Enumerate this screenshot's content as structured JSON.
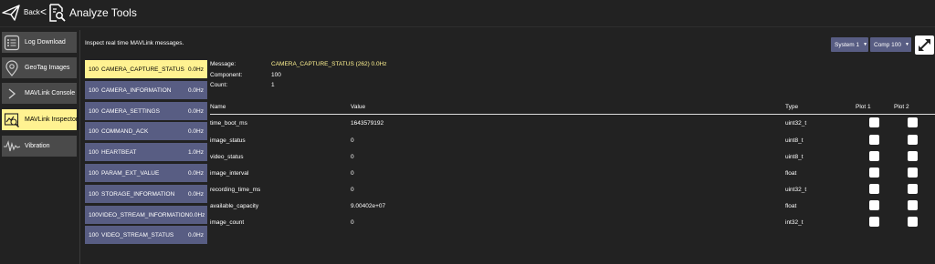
{
  "header": {
    "back_label": "Back",
    "back_chevron": "<",
    "title": "Analyze Tools",
    "back_icon": "paper-plane-icon",
    "title_icon": "analyze-document-icon"
  },
  "sidebar": {
    "items": [
      {
        "label": "Log Download",
        "icon": "log-list-icon",
        "active": false
      },
      {
        "label": "GeoTag Images",
        "icon": "map-pin-icon",
        "active": false
      },
      {
        "label": "MAVLink Console",
        "icon": "console-chevron-icon",
        "active": false
      },
      {
        "label": "MAVLink Inspector",
        "icon": "inspector-chart-icon",
        "active": true
      },
      {
        "label": "Vibration",
        "icon": "waveform-icon",
        "active": false
      }
    ]
  },
  "main": {
    "description": "Inspect real time MAVLink messages.",
    "system_dropdown": "System 1",
    "component_dropdown": "Comp 100",
    "messages": [
      {
        "id": "100",
        "name": "CAMERA_CAPTURE_STATUS",
        "rate": "0.0Hz",
        "active": true
      },
      {
        "id": "100",
        "name": "CAMERA_INFORMATION",
        "rate": "0.0Hz",
        "active": false
      },
      {
        "id": "100",
        "name": "CAMERA_SETTINGS",
        "rate": "0.0Hz",
        "active": false
      },
      {
        "id": "100",
        "name": "COMMAND_ACK",
        "rate": "0.0Hz",
        "active": false
      },
      {
        "id": "100",
        "name": "HEARTBEAT",
        "rate": "1.0Hz",
        "active": false
      },
      {
        "id": "100",
        "name": "PARAM_EXT_VALUE",
        "rate": "0.0Hz",
        "active": false
      },
      {
        "id": "100",
        "name": "STORAGE_INFORMATION",
        "rate": "0.0Hz",
        "active": false
      },
      {
        "id": "100",
        "name": "VIDEO_STREAM_INFORMATION",
        "rate": "0.0Hz",
        "active": false
      },
      {
        "id": "100",
        "name": "VIDEO_STREAM_STATUS",
        "rate": "0.0Hz",
        "active": false
      }
    ],
    "details": {
      "message_label": "Message:",
      "message_value": "CAMERA_CAPTURE_STATUS (262) 0.0Hz",
      "component_label": "Component:",
      "component_value": "100",
      "count_label": "Count:",
      "count_value": "1"
    },
    "table": {
      "headers": {
        "name": "Name",
        "value": "Value",
        "type": "Type",
        "plot1": "Plot 1",
        "plot2": "Plot 2"
      },
      "rows": [
        {
          "name": "time_boot_ms",
          "value": "1643579192",
          "type": "uint32_t",
          "plot1": false,
          "plot2": false
        },
        {
          "name": "image_status",
          "value": "0",
          "type": "uint8_t",
          "plot1": false,
          "plot2": false
        },
        {
          "name": "video_status",
          "value": "0",
          "type": "uint8_t",
          "plot1": false,
          "plot2": false
        },
        {
          "name": "image_interval",
          "value": "0",
          "type": "float",
          "plot1": false,
          "plot2": false
        },
        {
          "name": "recording_time_ms",
          "value": "0",
          "type": "uint32_t",
          "plot1": false,
          "plot2": false
        },
        {
          "name": "available_capacity",
          "value": "9.00402e+07",
          "type": "float",
          "plot1": false,
          "plot2": false
        },
        {
          "name": "image_count",
          "value": "0",
          "type": "int32_t",
          "plot1": false,
          "plot2": false
        }
      ]
    }
  },
  "colors": {
    "background": "#222222",
    "sidebar_button": "#4a4a4a",
    "message_button": "#585d83",
    "highlight": "#fff291",
    "text": "#ffffff"
  }
}
